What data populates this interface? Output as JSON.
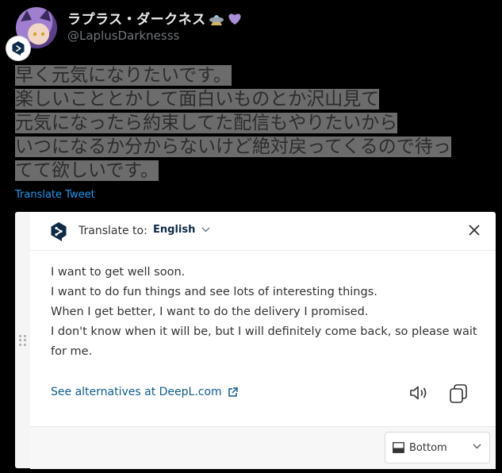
{
  "tweet": {
    "display_name": "ラプラス・ダークネス",
    "handle": "@LaplusDarknesss",
    "text_lines": [
      "早く元気になりたいです。",
      "楽しいこととかして面白いものとか沢山見て",
      "元気になったら約束してた配信もやりたいから",
      "いつになるか分からないけど絶対戻ってくるので待っ",
      "てて欲しいです。"
    ],
    "translate_link": "Translate Tweet",
    "name_emoji_icons": [
      "ufo-icon",
      "purple-heart-icon"
    ]
  },
  "deepl": {
    "translate_to_label": "Translate to:",
    "language": "English",
    "translation_lines": [
      "I want to get well soon.",
      "I want to do fun things and see lots of interesting things.",
      "When I get better, I want to do the delivery I promised.",
      "I don't know when it will be, but I will definitely come back, so please wait",
      "for me."
    ],
    "alternatives_link": "See alternatives at DeepL.com",
    "position_option": "Bottom",
    "colors": {
      "brand_dark": "#0f2b46",
      "link": "#0f5d8a",
      "twitter_blue": "#1d9bf0"
    }
  }
}
